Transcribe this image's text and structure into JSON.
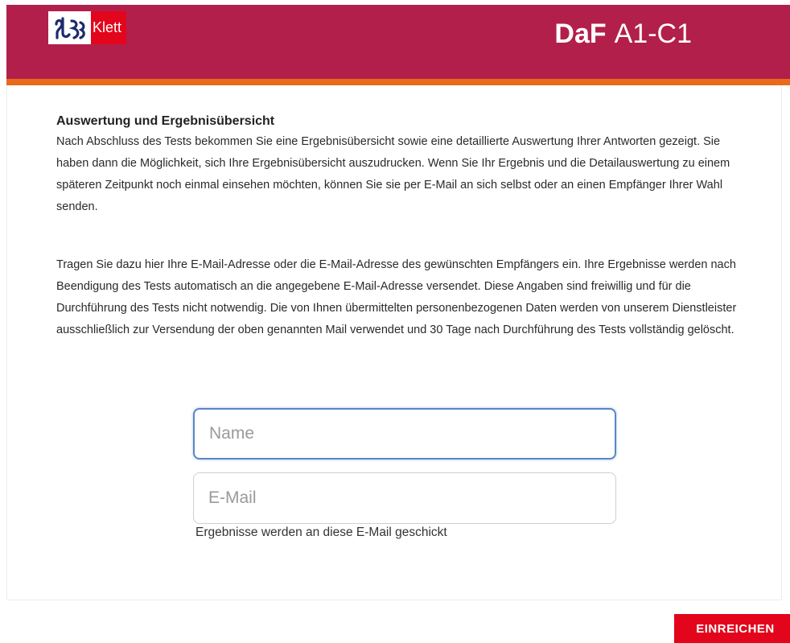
{
  "header": {
    "brand": "Klett",
    "product_main": "DaF",
    "product_level": "A1-C1",
    "colors": {
      "header_bg": "#b21f4b",
      "stripe": "#e86a1a",
      "logo_red": "#e3051b"
    }
  },
  "main": {
    "heading": "Auswertung und Ergebnisübersicht",
    "paragraph1": "Nach Abschluss des Tests bekommen Sie eine Ergebnisübersicht sowie eine detaillierte Auswertung Ihrer Antworten gezeigt. Sie haben dann die Möglichkeit, sich Ihre Ergebnisübersicht auszudrucken. Wenn Sie Ihr Ergebnis und die Detailauswertung zu einem späteren Zeitpunkt noch einmal einsehen möchten, können Sie sie per E-Mail an sich selbst oder an einen Empfänger Ihrer Wahl senden.",
    "paragraph2": "Tragen Sie dazu hier Ihre E-Mail-Adresse oder die E-Mail-Adresse des gewünschten Empfängers ein. Ihre Ergebnisse werden nach Beendigung des Tests automatisch an die angegebene E-Mail-Adresse versendet. Diese Angaben sind freiwillig und für die Durchführung des Tests nicht notwendig. Die von Ihnen übermittelten personenbezogenen Daten werden von unserem Dienstleister ausschließlich zur Versendung der oben genannten Mail verwendet und 30 Tage nach Durchführung des Tests vollständig gelöscht."
  },
  "form": {
    "name_placeholder": "Name",
    "name_value": "",
    "email_placeholder": "E-Mail",
    "email_value": "",
    "email_hint": "Ergebnisse werden an diese E-Mail geschickt"
  },
  "actions": {
    "submit_label": "EINREICHEN",
    "submit_color": "#e3051b"
  }
}
